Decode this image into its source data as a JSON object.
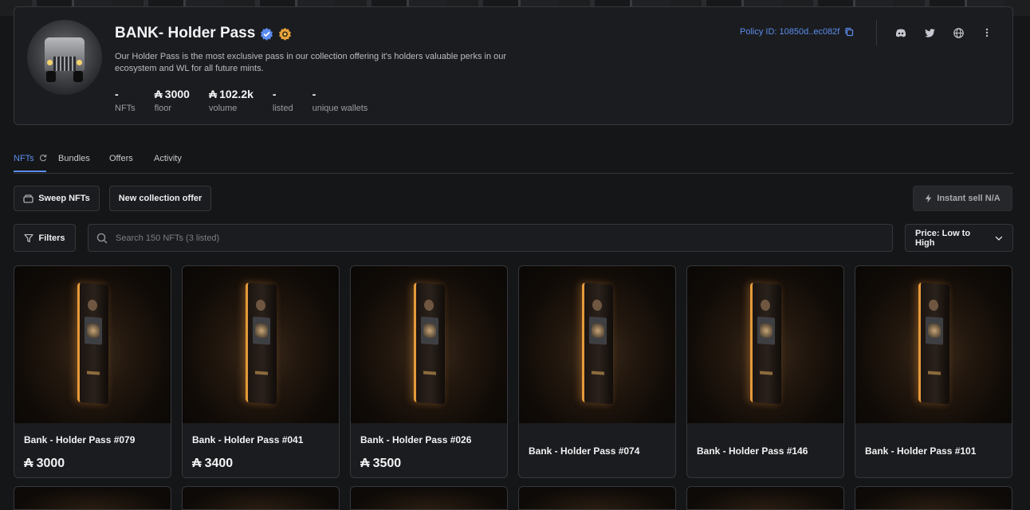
{
  "collection": {
    "title": "BANK- Holder Pass",
    "description": "Our Holder Pass is the most exclusive pass in our collection offering it's holders valuable perks in our ecosystem and WL for all future mints.",
    "policy_id": "Policy ID: 10850d..ec082f",
    "currency_symbol": "₳",
    "stats": [
      {
        "value": "-",
        "label": "NFTs",
        "ada": false
      },
      {
        "value": "3000",
        "label": "floor",
        "ada": true
      },
      {
        "value": "102.2k",
        "label": "volume",
        "ada": true
      },
      {
        "value": "-",
        "label": "listed",
        "ada": false
      },
      {
        "value": "-",
        "label": "unique wallets",
        "ada": false
      }
    ],
    "social_icons": [
      "discord-icon",
      "twitter-icon",
      "globe-icon",
      "more-vertical-icon"
    ]
  },
  "tabs": [
    {
      "label": "NFTs",
      "active": true
    },
    {
      "label": "Bundles",
      "active": false
    },
    {
      "label": "Offers",
      "active": false
    },
    {
      "label": "Activity",
      "active": false
    }
  ],
  "toolbar": {
    "sweep_label": "Sweep NFTs",
    "offer_label": "New collection offer",
    "instant_sell_label": "Instant sell N/A",
    "filters_label": "Filters",
    "search_placeholder": "Search 150 NFTs (3 listed)",
    "sort_label": "Price: Low to High"
  },
  "cards": [
    {
      "name": "Bank - Holder Pass #079",
      "price": "3000"
    },
    {
      "name": "Bank - Holder Pass #041",
      "price": "3400"
    },
    {
      "name": "Bank - Holder Pass #026",
      "price": "3500"
    },
    {
      "name": "Bank - Holder Pass #074",
      "price": null
    },
    {
      "name": "Bank - Holder Pass #146",
      "price": null
    },
    {
      "name": "Bank - Holder Pass #101",
      "price": null
    }
  ],
  "colors": {
    "accent": "#5b8def",
    "background": "#151617",
    "card": "#1b1c1f",
    "border": "#35373b"
  }
}
